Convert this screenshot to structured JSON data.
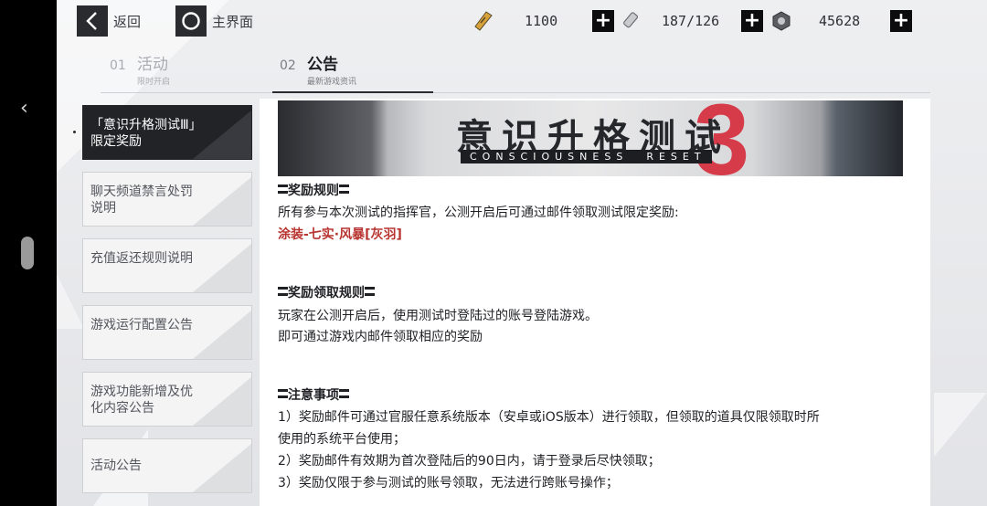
{
  "topbar": {
    "back_label": "返回",
    "home_label": "主界面",
    "resources": [
      {
        "icon": "ticket-icon",
        "value": "1100"
      },
      {
        "icon": "battery-icon",
        "value": "187/126"
      },
      {
        "icon": "nut-icon",
        "value": "45628"
      }
    ],
    "plus_symbol": "+"
  },
  "tabs": [
    {
      "num": "01",
      "title": "活动",
      "sub": "限时开启",
      "active": false
    },
    {
      "num": "02",
      "title": "公告",
      "sub": "最新游戏资讯",
      "active": true
    }
  ],
  "sidebar": {
    "items": [
      {
        "label": "「意识升格测试Ⅲ」限定奖励",
        "active": true
      },
      {
        "label": "聊天频道禁言处罚说明",
        "active": false
      },
      {
        "label": "充值返还规则说明",
        "active": false
      },
      {
        "label": "游戏运行配置公告",
        "active": false
      },
      {
        "label": "游戏功能新增及优化内容公告",
        "active": false
      },
      {
        "label": "活动公告",
        "active": false
      }
    ]
  },
  "banner": {
    "title": "意识升格测试",
    "subtitle_left": "CONSCIOUSNESS",
    "subtitle_right": "RESET",
    "numeral": "3"
  },
  "article": {
    "h1": "奖励规则",
    "p1": "所有参与本次测试的指挥官，公测开启后可通过邮件领取测试限定奖励:",
    "reward": "涂装-七实·风暴[灰羽]",
    "h2": "奖励领取规则",
    "p2": "玩家在公测开启后，使用测试时登陆过的账号登陆游戏。",
    "p3": "即可通过游戏内邮件领取相应的奖励",
    "h3": "注意事项",
    "n1a": "1）奖励邮件可通过官服任意系统版本（安卓或iOS版本）进行领取，但领取的道具仅限领取时所",
    "n1b": "使用的系统平台使用；",
    "n2": "2）奖励邮件有效期为首次登陆后的90日内，请于登录后尽快领取；",
    "n3": "3）奖励仅限于参与测试的账号领取，无法进行跨账号操作；"
  },
  "colors": {
    "accent_red": "#b83430",
    "dark": "#222327",
    "banner_numeral": "#d62a3b"
  }
}
